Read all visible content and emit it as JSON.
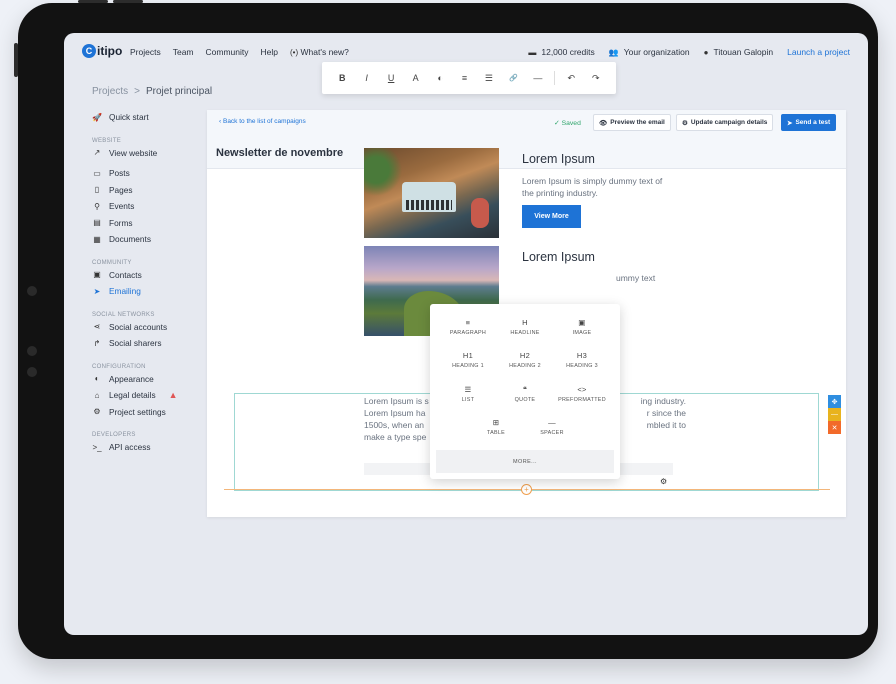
{
  "nav": {
    "logo": "itipo",
    "logo_mark": "C",
    "links": [
      "Projects",
      "Team",
      "Community",
      "Help"
    ],
    "whats_new": "What's new?",
    "credits": "12,000 credits",
    "organization": "Your organization",
    "user": "Titouan Galopin",
    "launch": "Launch a project"
  },
  "breadcrumb": {
    "root": "Projects",
    "separator": ">",
    "current": "Projet principal"
  },
  "format_toolbar": [
    "B",
    "I",
    "U",
    "A",
    "◐",
    "≡",
    "☰",
    "🔗",
    "—",
    "↶",
    "↷"
  ],
  "sidebar": {
    "quick_start": "Quick start",
    "sections": [
      {
        "heading": "WEBSITE",
        "items": [
          "View website"
        ]
      },
      {
        "heading": "",
        "items": [
          "Posts",
          "Pages",
          "Events",
          "Forms",
          "Documents"
        ]
      },
      {
        "heading": "COMMUNITY",
        "items": [
          "Contacts",
          "Emailing"
        ]
      },
      {
        "heading": "SOCIAL NETWORKS",
        "items": [
          "Social accounts",
          "Social sharers"
        ]
      },
      {
        "heading": "CONFIGURATION",
        "items": [
          "Appearance",
          "Legal details",
          "Project settings"
        ]
      },
      {
        "heading": "DEVELOPERS",
        "items": [
          "API access"
        ]
      }
    ],
    "active": "Emailing"
  },
  "panel": {
    "back": "Back to the list of campaigns",
    "saved": "Saved",
    "preview": "Preview the email",
    "update": "Update campaign details",
    "send_test": "Send a test",
    "title": "Newsletter de novembre"
  },
  "email": {
    "heading1": "Lorem Ipsum",
    "text1": "Lorem Ipsum is simply dummy text of the printing industry.",
    "button": "View More",
    "heading2": "Lorem Ipsum",
    "text2_visible": "ummy text",
    "body_left": "Lorem Ipsum is s\nLorem Ipsum ha\n1500s, when an\nmake a type spe",
    "body_right": "ing industry.\nr since the\nmbled it to"
  },
  "picker": {
    "items": [
      {
        "label": "PARAGRAPH",
        "icon": "≡"
      },
      {
        "label": "HEADLINE",
        "icon": "H"
      },
      {
        "label": "IMAGE",
        "icon": "▣"
      },
      {
        "label": "HEADING 1",
        "icon": "H1"
      },
      {
        "label": "HEADING 2",
        "icon": "H2"
      },
      {
        "label": "HEADING 3",
        "icon": "H3"
      },
      {
        "label": "LIST",
        "icon": "☰"
      },
      {
        "label": "QUOTE",
        "icon": "❝"
      },
      {
        "label": "PREFORMATTED",
        "icon": "<>"
      },
      {
        "label": "TABLE",
        "icon": "⊞"
      },
      {
        "label": "SPACER",
        "icon": "—"
      }
    ],
    "more": "MORE..."
  },
  "colors": {
    "accent": "#1e73d6",
    "saved": "#2fa56b",
    "warning": "#e05656",
    "tool_blue": "#2f8ee0",
    "tool_yellow": "#e8b31e",
    "tool_orange": "#f26a2a"
  }
}
